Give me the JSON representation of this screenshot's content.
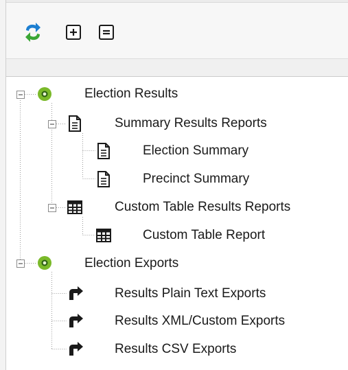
{
  "toolbar": {
    "refresh": {
      "icon": "refresh-arrows-icon"
    },
    "expand_all": {
      "icon": "expand-all-icon"
    },
    "collapse_all": {
      "icon": "collapse-all-icon"
    }
  },
  "tree": {
    "election_results": {
      "label": "Election Results",
      "icon": "green-circle-icon",
      "summary_reports": {
        "label": "Summary Results Reports",
        "icon": "document-icon",
        "election_summary": {
          "label": "Election Summary",
          "icon": "document-icon"
        },
        "precinct_summary": {
          "label": "Precinct Summary",
          "icon": "document-icon"
        }
      },
      "custom_table_reports": {
        "label": "Custom Table Results Reports",
        "icon": "table-grid-icon",
        "custom_table_report": {
          "label": "Custom Table Report",
          "icon": "table-grid-icon"
        }
      }
    },
    "election_exports": {
      "label": "Election Exports",
      "icon": "green-circle-icon",
      "plain_text": {
        "label": "Results Plain Text Exports",
        "icon": "export-arrow-icon"
      },
      "xml_custom": {
        "label": "Results XML/Custom Exports",
        "icon": "export-arrow-icon"
      },
      "csv": {
        "label": "Results CSV Exports",
        "icon": "export-arrow-icon"
      }
    }
  },
  "colors": {
    "green": "#7ab929",
    "refresh_blue": "#1d7fd1",
    "refresh_green": "#3aa635",
    "tree_line": "#9a9a9a"
  }
}
